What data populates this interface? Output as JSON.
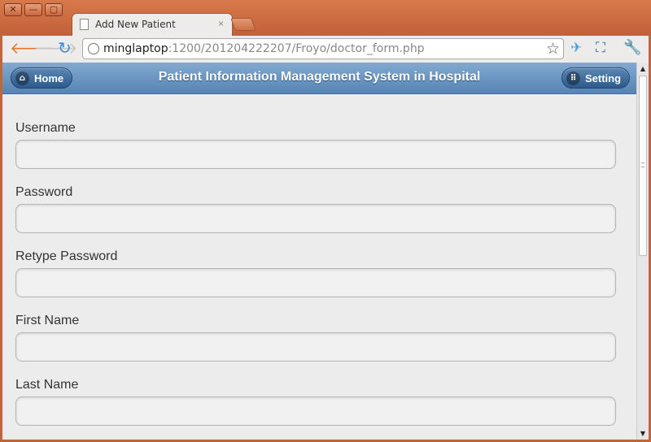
{
  "window": {
    "close_glyph": "✕",
    "minimize_glyph": "—",
    "maximize_glyph": "▢"
  },
  "tab": {
    "title": "Add New Patient",
    "close_glyph": "×"
  },
  "toolbar": {
    "url_host": "minglaptop",
    "url_rest": ":1200/201204222207/Froyo/doctor_form.php"
  },
  "header": {
    "title": "Patient Information Management System in Hospital",
    "home_label": "Home",
    "setting_label": "Setting"
  },
  "form": {
    "fields": [
      {
        "label": "Username",
        "value": ""
      },
      {
        "label": "Password",
        "value": ""
      },
      {
        "label": "Retype Password",
        "value": ""
      },
      {
        "label": "First Name",
        "value": ""
      },
      {
        "label": "Last Name",
        "value": ""
      }
    ]
  },
  "colors": {
    "window_frame": "#c4643a",
    "header_blue": "#6a96c4",
    "page_bg": "#ececec"
  }
}
